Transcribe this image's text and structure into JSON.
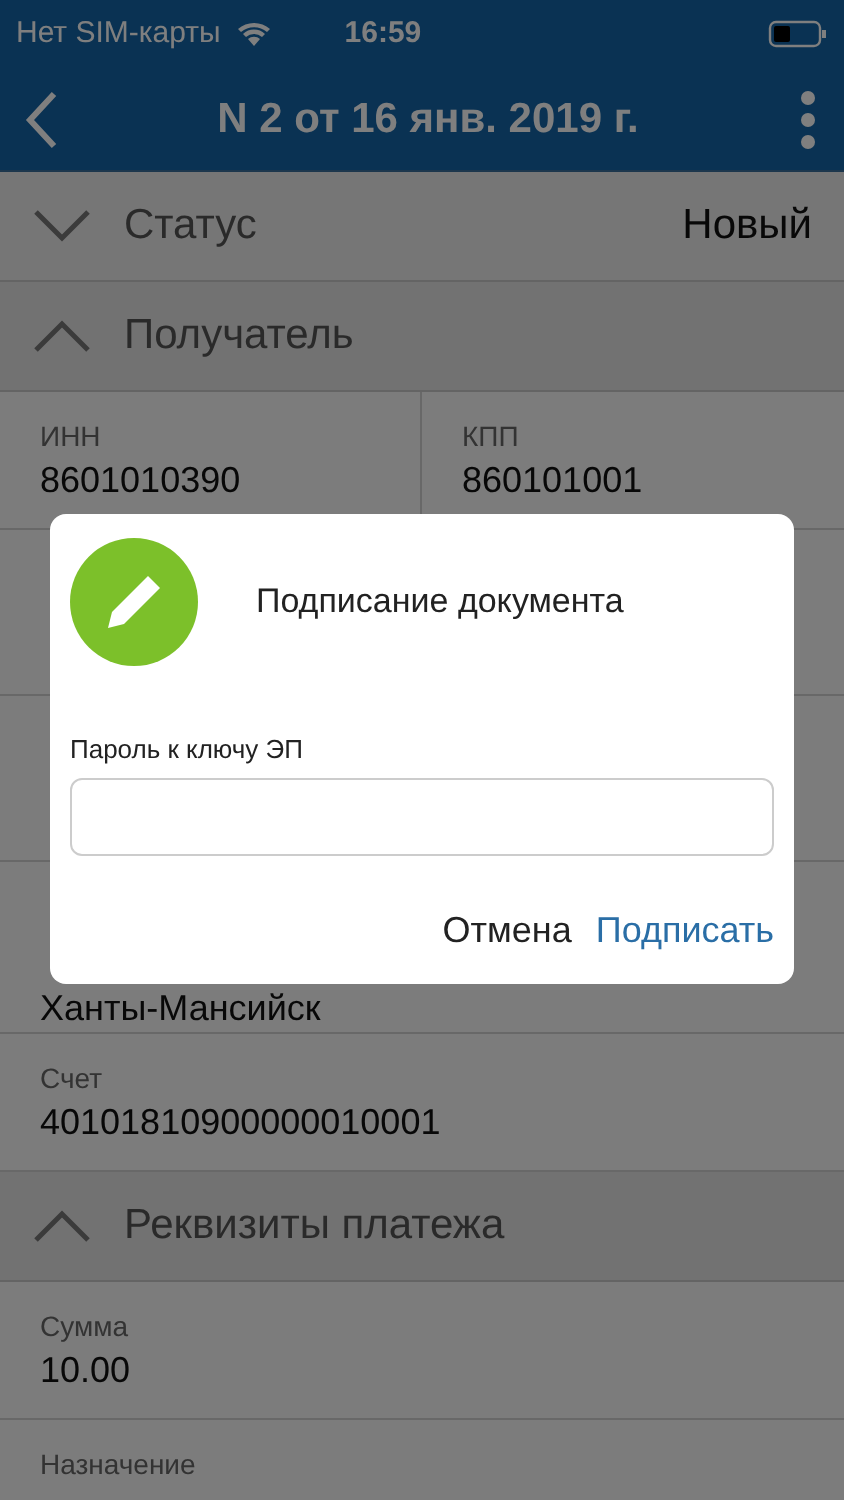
{
  "status_bar": {
    "carrier": "Нет SIM-карты",
    "time": "16:59"
  },
  "nav": {
    "title": "N 2 от 16 янв. 2019 г."
  },
  "sections": [
    {
      "title": "Статус",
      "expanded": false,
      "value": "Новый"
    },
    {
      "title": "Получатель",
      "expanded": true,
      "fields": [
        {
          "kind": "pair",
          "items": [
            {
              "label": "ИНН",
              "value": "8601010390"
            },
            {
              "label": "КПП",
              "value": "860101001"
            }
          ]
        },
        {
          "kind": "covered"
        },
        {
          "kind": "covered"
        },
        {
          "kind": "tail",
          "value": "Ханты-Мансийск"
        },
        {
          "kind": "field",
          "label": "Счет",
          "value": "40101810900000010001"
        }
      ]
    },
    {
      "title": "Реквизиты платежа",
      "expanded": true,
      "fields": [
        {
          "kind": "field",
          "label": "Сумма",
          "value": "10.00"
        },
        {
          "kind": "label",
          "label": "Назначение"
        }
      ]
    }
  ],
  "dialog": {
    "title": "Подписание документа",
    "field_label": "Пароль к ключу ЭП",
    "buttons": [
      {
        "label": "Отмена",
        "kind": "cancel"
      },
      {
        "label": "Подписать",
        "kind": "primary"
      }
    ]
  }
}
